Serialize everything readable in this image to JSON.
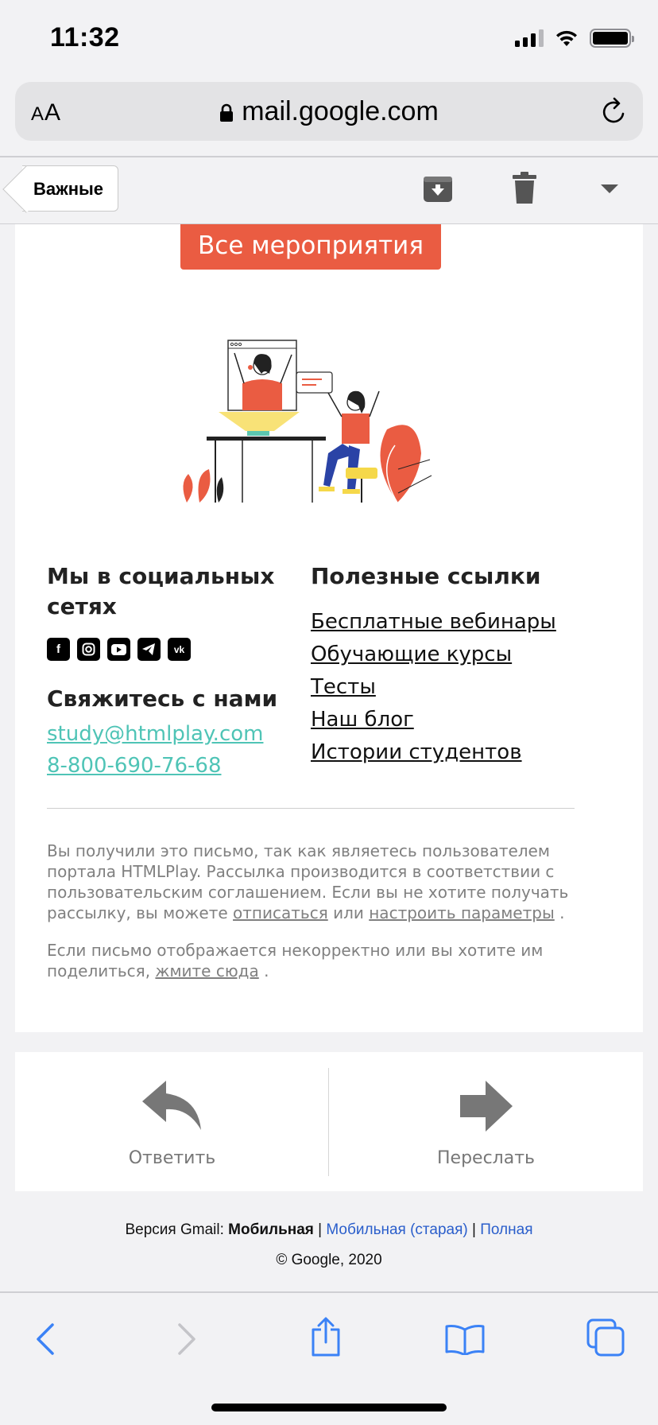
{
  "status": {
    "time": "11:32"
  },
  "browser": {
    "aa_small": "A",
    "aa_large": "A",
    "url": "mail.google.com"
  },
  "gmail_toolbar": {
    "back_label": "Важные"
  },
  "email": {
    "cta_label": "Все мероприятия",
    "social_title": "Мы в социальных сетях",
    "social_icons": [
      "facebook-icon",
      "instagram-icon",
      "youtube-icon",
      "telegram-icon",
      "vk-icon"
    ],
    "contact_title": "Свяжитесь с нами",
    "contact_email": "study@htmlplay.com",
    "contact_phone": "8-800-690-76-68",
    "links_title": "Полезные ссылки",
    "links": [
      "Бесплатные вебинары",
      "Обучающие курсы",
      "Тесты",
      "Наш блог",
      "Истории студентов"
    ],
    "fine_1_text": "Вы получили это письмо, так как являетесь пользователем портала HTMLPlay. Рассылка производится в соответствии с пользовательским соглашением. Если вы не хотите получать рассылку, вы можете",
    "fine_1_link1": "отписаться",
    "fine_1_or": "или",
    "fine_1_link2": "настроить параметры",
    "fine_2_text": "Если письмо отображается некорректно или вы хотите им поделиться,",
    "fine_2_link": "жмите сюда",
    "accent_color": "#ea5c42",
    "link_color": "#4fc4b6"
  },
  "actions": {
    "reply": "Ответить",
    "forward": "Переслать"
  },
  "footer": {
    "version_prefix": "Версия Gmail:",
    "version_current": "Мобильная",
    "version_old": "Мобильная (старая)",
    "version_full": "Полная",
    "separator": "|",
    "copyright": "© Google, 2020"
  }
}
